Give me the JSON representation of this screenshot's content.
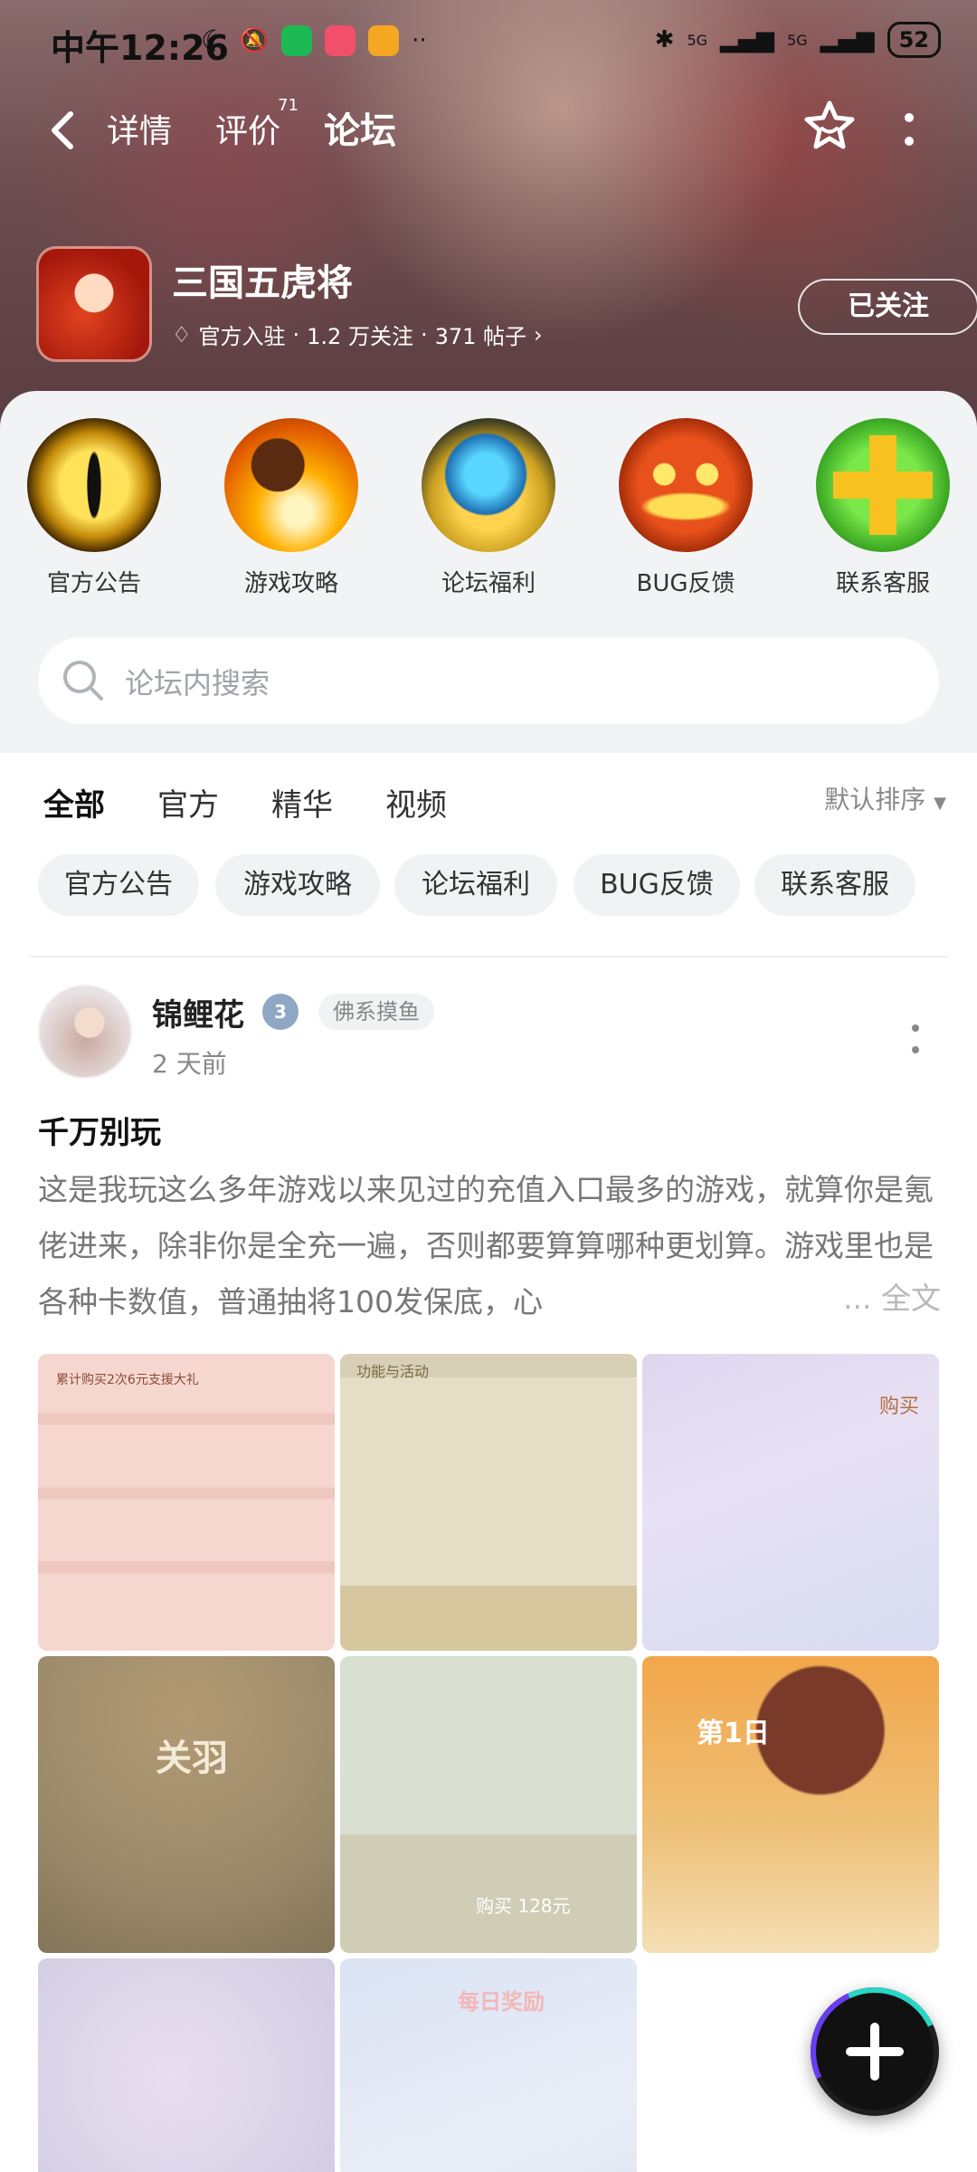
{
  "status_bar": {
    "time": "中午12:26",
    "battery": "52",
    "signal_1": "5G",
    "signal_2": "5G"
  },
  "nav": {
    "tab_detail": "详情",
    "tab_review": "评价",
    "review_count": "71",
    "tab_forum": "论坛"
  },
  "game": {
    "title": "三国五虎将",
    "official": "官方入驻",
    "followers": "1.2 万关注",
    "posts": "371 帖子",
    "follow_button": "已关注"
  },
  "categories": [
    {
      "label": "官方公告",
      "icon": "yellow-eye-icon"
    },
    {
      "label": "游戏攻略",
      "icon": "flame-fist-icon"
    },
    {
      "label": "论坛福利",
      "icon": "blue-gauntlet-icon"
    },
    {
      "label": "BUG反馈",
      "icon": "pumpkin-icon"
    },
    {
      "label": "联系客服",
      "icon": "green-plus-icon"
    }
  ],
  "search": {
    "placeholder": "论坛内搜索"
  },
  "filters": {
    "tabs": [
      "全部",
      "官方",
      "精华",
      "视频"
    ],
    "active": "全部",
    "sort": "默认排序"
  },
  "chips": [
    "官方公告",
    "游戏攻略",
    "论坛福利",
    "BUG反馈",
    "联系客服"
  ],
  "post": {
    "author": "锦鲤花",
    "level": "3",
    "tag": "佛系摸鱼",
    "time": "2 天前",
    "title": "千万别玩",
    "body": "这是我玩这么多年游戏以来见过的充值入口最多的游戏，就算你是氪佬进来，除非你是全充一遍，否则都要算算哪种更划算。游戏里也是各种卡数值，普通抽将100发保底，心",
    "more": "... 全文",
    "images": [
      {
        "name": "recharge-gifts-screenshot",
        "text": "累计购买2次6元支援大礼"
      },
      {
        "name": "function-activity-screenshot",
        "text": "功能与活动"
      },
      {
        "name": "coin-purchase-screenshot",
        "text": "购买"
      },
      {
        "name": "guanyu-screenshot",
        "text": "关羽"
      },
      {
        "name": "daily-pack-screenshot",
        "text": "购买 128元"
      },
      {
        "name": "first-day-screenshot",
        "text": "第1日"
      },
      {
        "name": "heroine-screenshot",
        "text": ""
      },
      {
        "name": "daily-reward-screenshot",
        "text": "每日奖励"
      }
    ]
  },
  "colors": {
    "accent": "#2ad4c4",
    "fab": "#111111"
  }
}
